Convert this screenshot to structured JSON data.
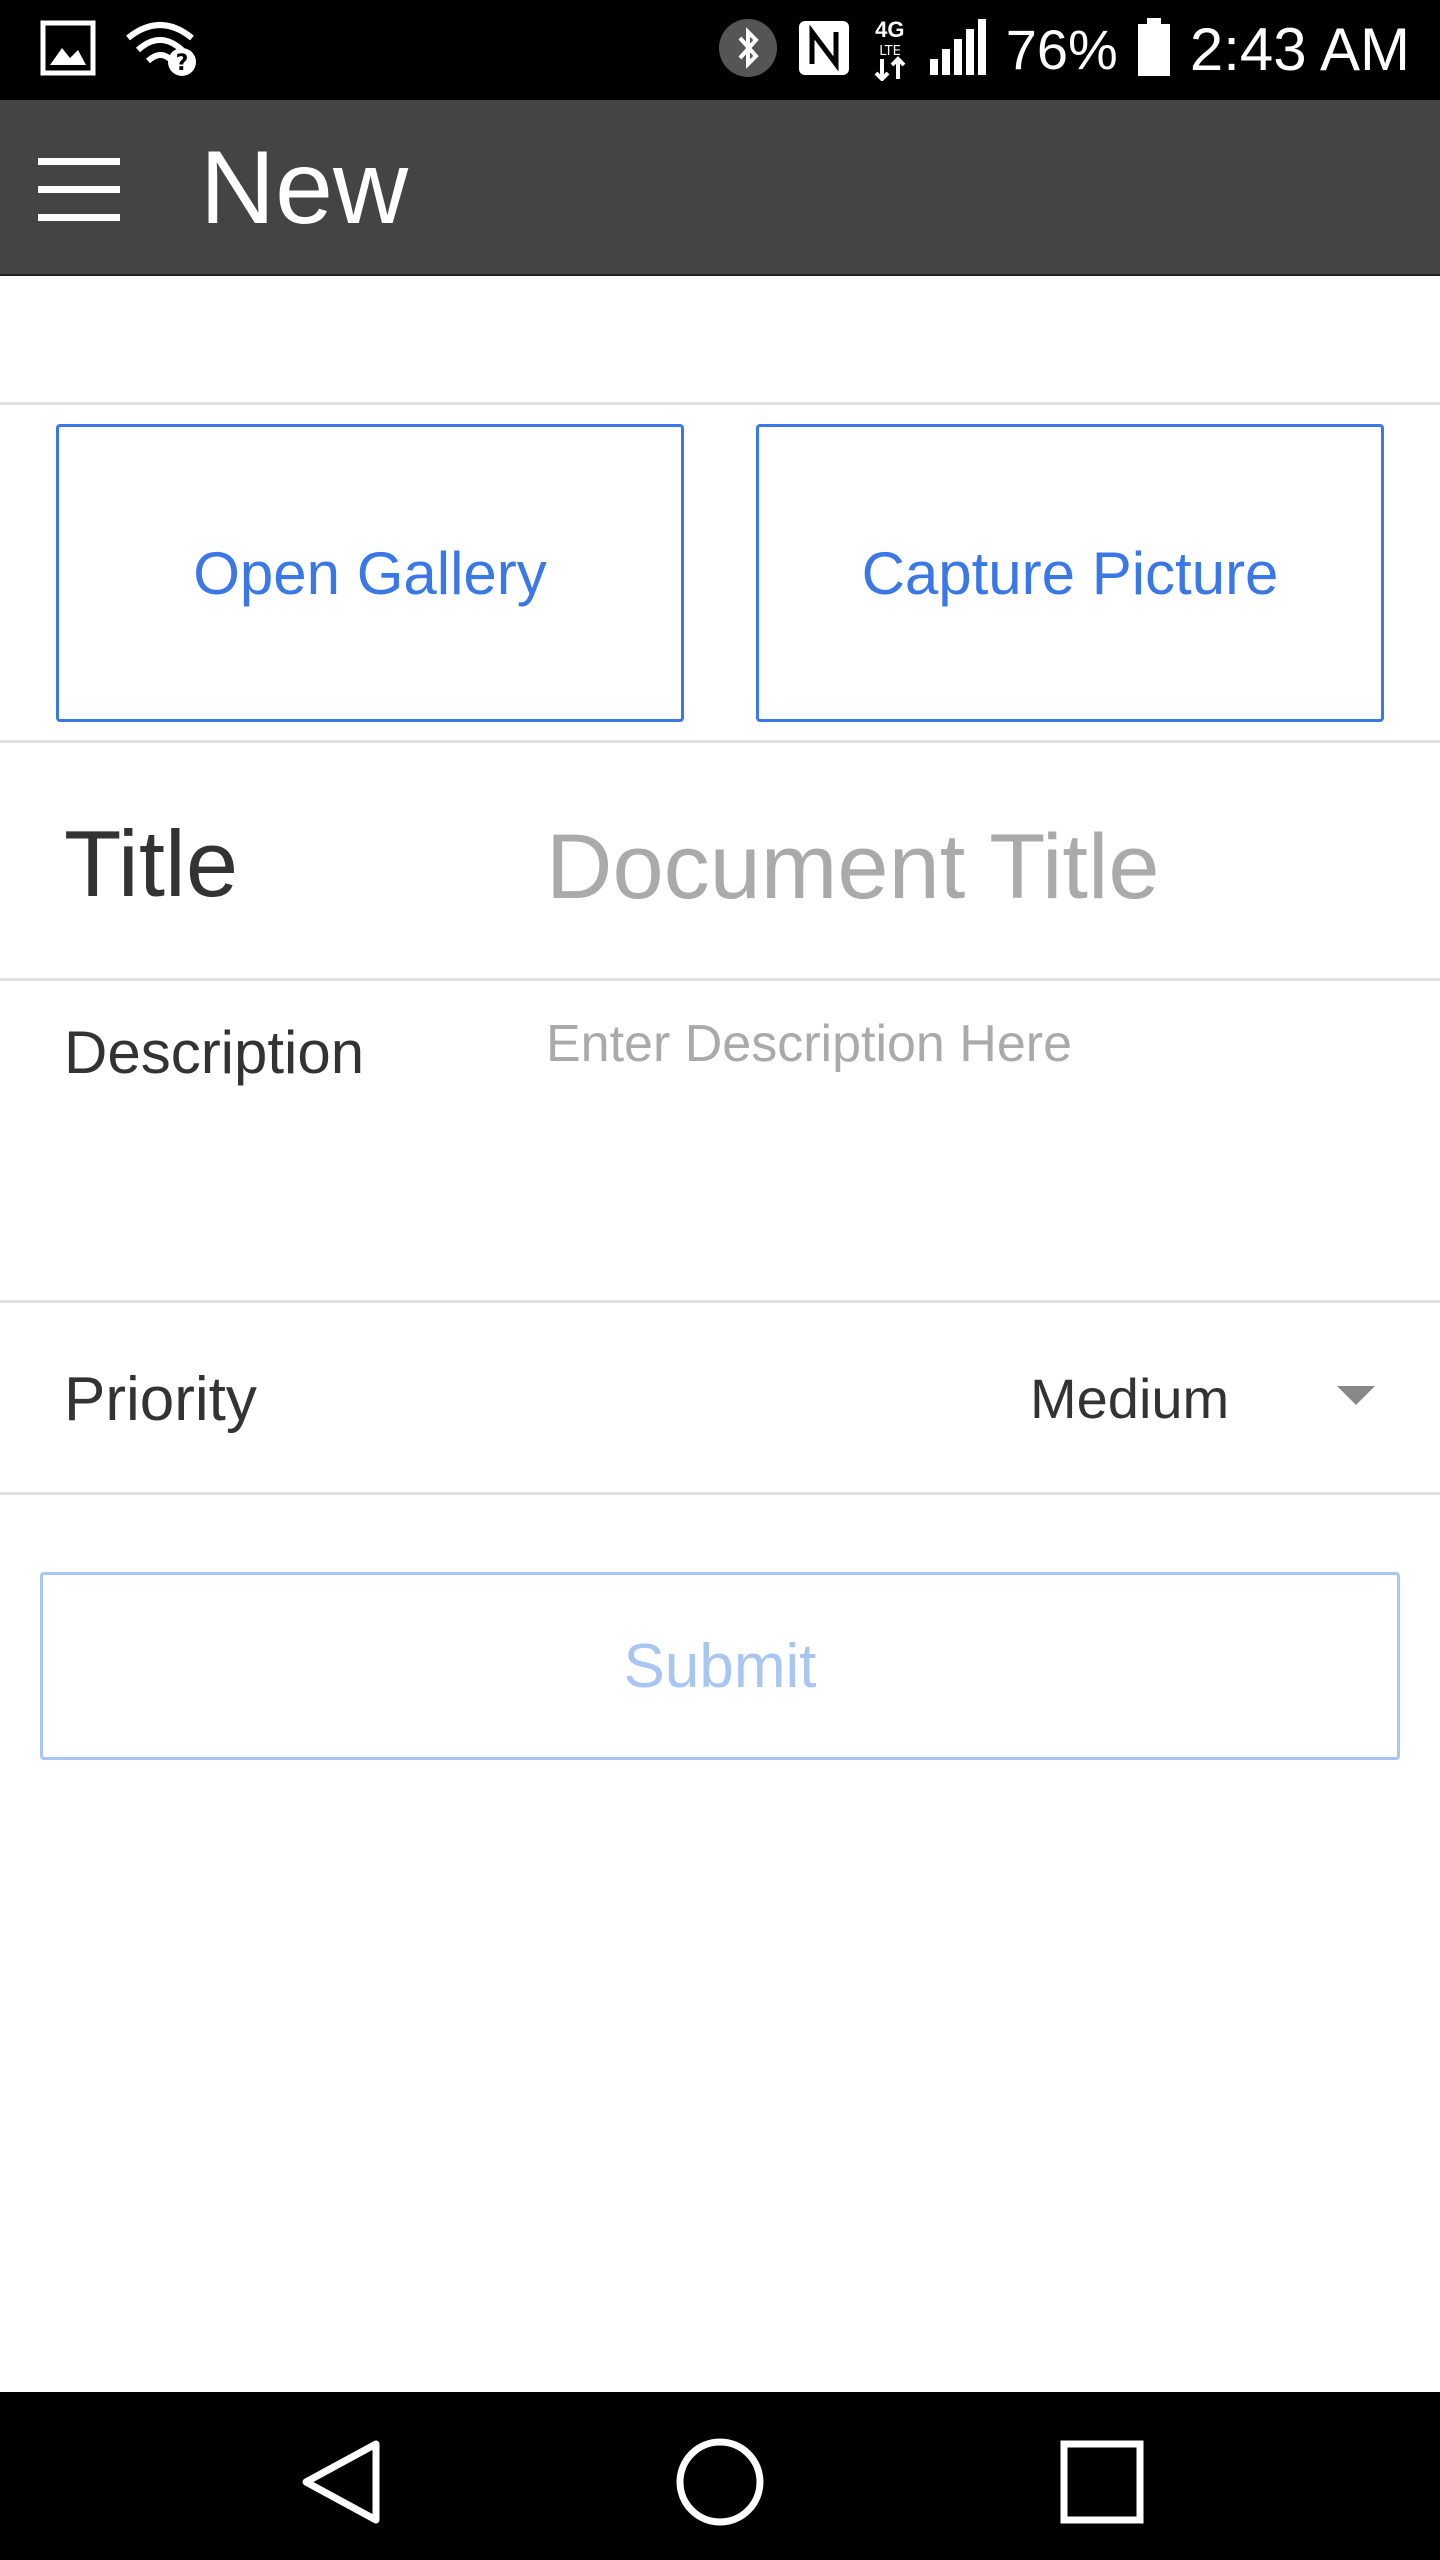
{
  "status_bar": {
    "icons": [
      "image-icon",
      "wifi-question-icon",
      "bluetooth-icon",
      "nfc-icon",
      "network-4g-lte-icon",
      "signal-icon",
      "battery-icon"
    ],
    "network_label": "4G",
    "battery": "76%",
    "time": "2:43 AM"
  },
  "app_bar": {
    "title": "New",
    "menu_icon": "hamburger-menu-icon"
  },
  "photo": {
    "open_gallery": "Open Gallery",
    "capture_picture": "Capture Picture"
  },
  "form": {
    "title_label": "Title",
    "title_placeholder": "Document Title",
    "description_label": "Description",
    "description_placeholder": "Enter Description Here",
    "priority_label": "Priority",
    "priority_value": "Medium",
    "submit_label": "Submit"
  },
  "colors": {
    "accent": "#3b78e7",
    "accent_disabled": "#a9c6f2",
    "app_bar": "#444444"
  },
  "nav_bar": {
    "icons": [
      "back-icon",
      "home-icon",
      "recents-icon"
    ]
  }
}
